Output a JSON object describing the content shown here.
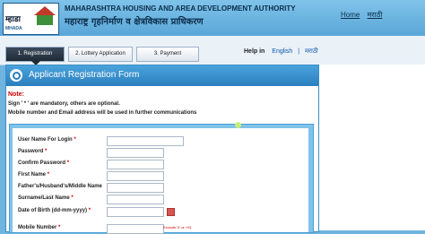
{
  "header": {
    "logo_text": "म्हाडा",
    "logo_sub": "MHADA",
    "org_en": "MAHARASHTRA HOUSING AND AREA DEVELOPMENT AUTHORITY",
    "org_mr": "महाराष्ट्र गृहनिर्माण व क्षेत्रविकास प्राधिकरण",
    "links": [
      "Home",
      "मराठी"
    ]
  },
  "tabs": [
    "1. Registration",
    "2. Lottery Application",
    "3. Payment"
  ],
  "help": {
    "label": "Help in",
    "langs": [
      "English",
      "मराठी"
    ]
  },
  "form": {
    "title": "Applicant Registration Form",
    "note_label": "Note:",
    "note1": "Sign ' * ' are mandatory, others are optional.",
    "note2": "Mobile number and Email address will be used in further communications",
    "fields": [
      {
        "label": "User Name For Login",
        "req": "*"
      },
      {
        "label": "Password",
        "req": "*"
      },
      {
        "label": "Confirm Password",
        "req": "*"
      },
      {
        "label": "First Name",
        "req": "*"
      },
      {
        "label": "Father's/Husband's/Middle Name",
        "req": ""
      },
      {
        "label": "Surname/Last Name",
        "req": "*"
      },
      {
        "label": "Date of Birth (dd-mm-yyyy)",
        "req": "*"
      },
      {
        "label": "Mobile Number",
        "req": "*"
      }
    ],
    "mobile_hint": "Exclude '0' or +91"
  }
}
